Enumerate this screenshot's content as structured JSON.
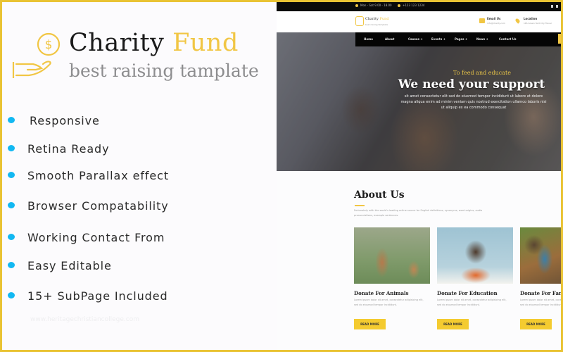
{
  "promo": {
    "brand_name": "Charity",
    "brand_accent": "Fund",
    "tagline": "best raising tamplate",
    "logo_icon": "hand-coin-icon",
    "features": [
      "Responsive",
      "Retina Ready",
      "Smooth Parallax effect",
      "Browser Compatability",
      "Working Contact From",
      "Easy Editable",
      "15+ SubPage Included"
    ],
    "watermark": "www.heritagechristiancollege.com"
  },
  "colors": {
    "accent": "#f1c644",
    "frame": "#e9c334",
    "bullet": "#12b8f2",
    "nav_bg": "#050505"
  },
  "site": {
    "topbar": {
      "hours": "Mon - Sat 9.00 - 18.00",
      "phone": "+123 123 1234"
    },
    "header": {
      "brand_name": "Charity",
      "brand_accent": "Fund",
      "tagline": "best raising tamplate",
      "email_title": "Email Us",
      "email_sub": "info@charity.com",
      "location_title": "Location",
      "location_sub": "1PA Green Yard City Travel"
    },
    "nav": [
      "Home",
      "About",
      "Causes +",
      "Events +",
      "Pages +",
      "News +",
      "Contact Us"
    ],
    "hero": {
      "subtitle": "To feed and educate",
      "title": "We need your support",
      "text": "sit amet consectetur elit sed do eiusmod tempor incididunt ut labore et dolore magna aliqua enim ad minim veniam quis nostrud exercitation ullamco laboris nisi ut aliquip ex ea commodo consequat"
    },
    "about": {
      "title": "About Us",
      "text": "Fortunately with the world's leading online source for English definitions, synonyms, word origins, audio pronunciations, example sentences."
    },
    "cards": [
      {
        "title": "Donate For Animals",
        "text": "Lorem ipsum dolor sit amet, consectetur adipisicing elit, sed do eiusmod tempor incididunt.",
        "button": "READ MORE"
      },
      {
        "title": "Donate For Education",
        "text": "Lorem ipsum dolor sit amet, consectetur adipisicing elit, sed do eiusmod tempor incididunt.",
        "button": "READ MORE"
      },
      {
        "title": "Donate For Family",
        "text": "Lorem ipsum dolor sit amet, consectetur adipisicing elit, sed do eiusmod tempor incididunt.",
        "button": "READ MORE"
      }
    ]
  }
}
